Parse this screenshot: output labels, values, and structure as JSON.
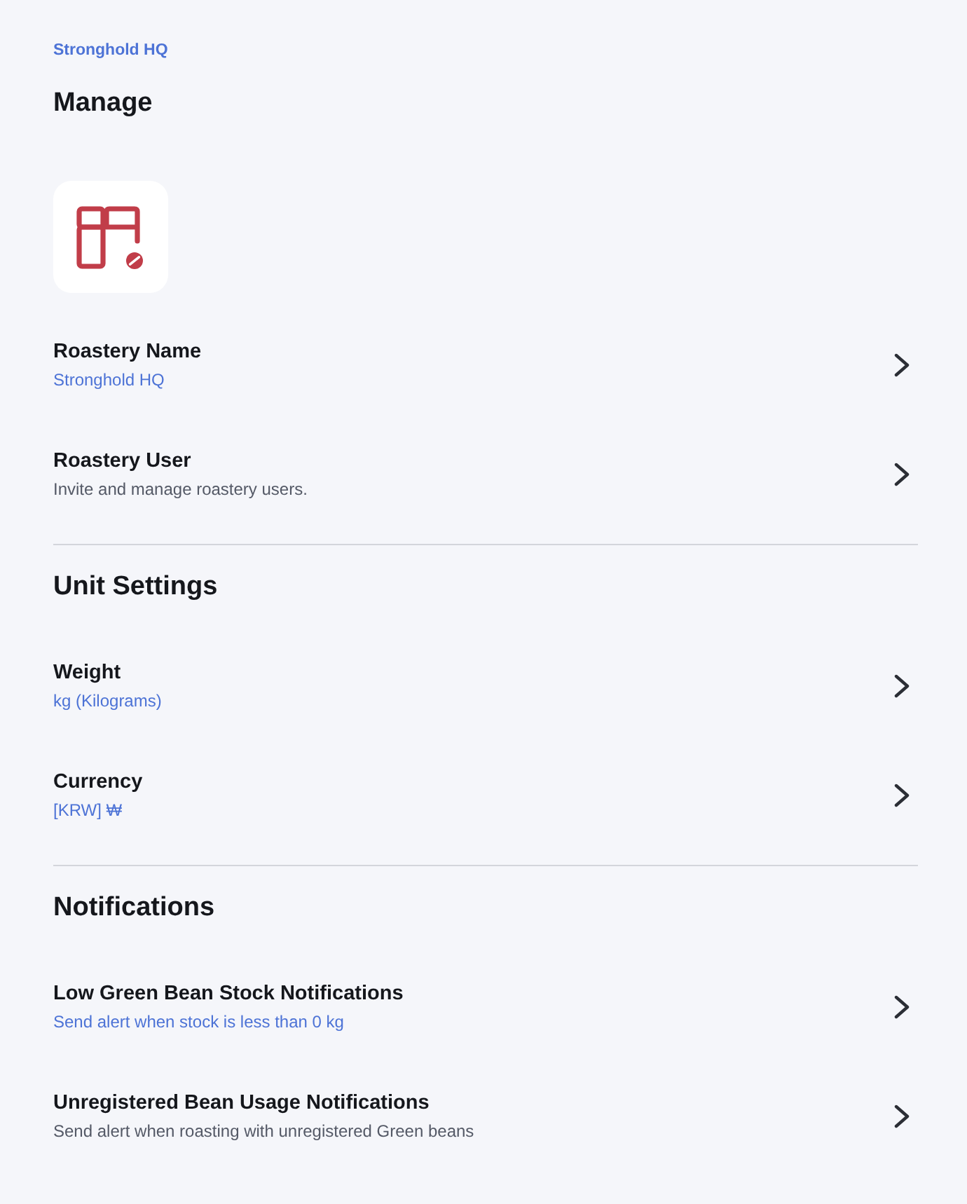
{
  "breadcrumb": "Stronghold HQ",
  "sections": [
    {
      "heading": "Manage",
      "logo": true,
      "rows": [
        {
          "title": "Roastery Name",
          "detail": "Stronghold HQ",
          "kind": "value"
        },
        {
          "title": "Roastery User",
          "detail": "Invite and manage roastery users.",
          "kind": "description"
        }
      ]
    },
    {
      "heading": "Unit Settings",
      "rows": [
        {
          "title": "Weight",
          "detail": "kg (Kilograms)",
          "kind": "value"
        },
        {
          "title": "Currency",
          "detail": "[KRW] ₩",
          "kind": "value"
        }
      ]
    },
    {
      "heading": "Notifications",
      "rows": [
        {
          "title": "Low Green Bean Stock Notifications",
          "detail": "Send alert when stock is less than 0 kg",
          "kind": "value"
        },
        {
          "title": "Unregistered Bean Usage Notifications",
          "detail": "Send alert when roasting with unregistered Green beans",
          "kind": "description"
        }
      ]
    }
  ]
}
